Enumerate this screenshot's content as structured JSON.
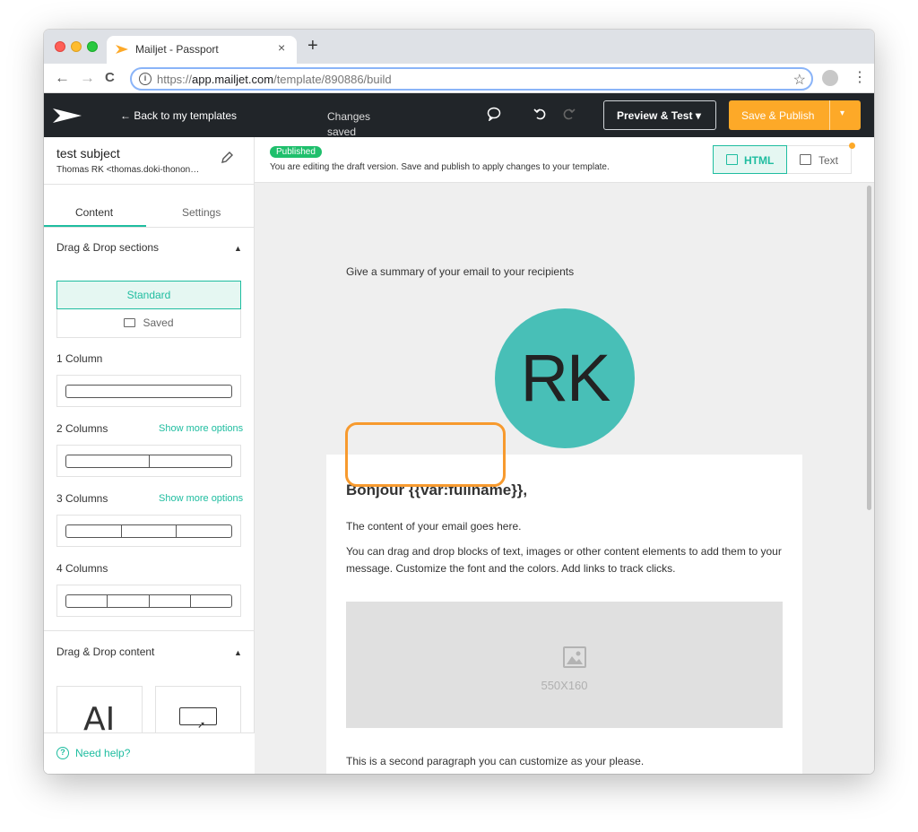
{
  "browser": {
    "tab_title": "Mailjet - Passport",
    "tab_close": "×",
    "new_tab": "+",
    "url_host": "app.mailjet.com",
    "url_prefix": "https://",
    "url_path": "/template/890886/build",
    "nav": {
      "back": "←",
      "forward": "→",
      "reload": "C",
      "star": "☆",
      "menu": "⋮"
    }
  },
  "header": {
    "back_label": "← Back to my templates",
    "status": "Changes saved",
    "preview_label": "Preview & Test ▾",
    "publish_label": "Save & Publish",
    "publish_caret": "▾",
    "icons": {
      "comment": "comment-icon",
      "undo": "undo-icon",
      "redo": "redo-icon"
    }
  },
  "sidebar": {
    "subject": "test subject",
    "from": "Thomas RK <thomas.doki-thonon@mailjet.com>",
    "tabs": [
      "Content",
      "Settings"
    ],
    "sections_title": "Drag & Drop sections",
    "standard_label": "Standard",
    "saved_label": "Saved",
    "columns": [
      {
        "label": "1 Column",
        "more": ""
      },
      {
        "label": "2 Columns",
        "more": "Show more options"
      },
      {
        "label": "3 Columns",
        "more": "Show more options"
      },
      {
        "label": "4 Columns",
        "more": ""
      }
    ],
    "content_title": "Drag & Drop content",
    "help_label": "Need help?"
  },
  "notice": {
    "badge": "Published",
    "text": "You are editing the draft version. Save and publish to apply changes to your template.",
    "html_label": "HTML",
    "text_label": "Text"
  },
  "email": {
    "summary": "Give a summary of your email to your recipients",
    "avatar_initials": "RK",
    "greeting": "Bonjour {{var:fullname}},",
    "p1": "The content of your email goes here.",
    "p2": "You can drag and drop blocks of text, images or other content elements to add them to your message. Customize the font and the colors. Add links to track clicks.",
    "image_size": "550X160",
    "p3": "This is a second paragraph you can customize as your please."
  },
  "colors": {
    "accent": "#1fbda0",
    "publish": "#fda928",
    "header_bg": "#212529",
    "avatar": "#48bfb7",
    "highlight": "#f79a2e",
    "badge": "#1fbf6c"
  }
}
